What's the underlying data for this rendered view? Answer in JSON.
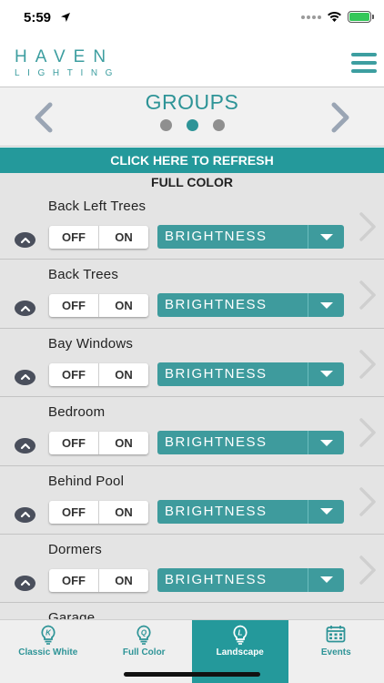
{
  "status_bar": {
    "time": "5:59"
  },
  "header": {
    "logo_main": "HAVEN",
    "logo_sub": "LIGHTING"
  },
  "groups_nav": {
    "title": "GROUPS",
    "pages": 3,
    "active_page": 2
  },
  "refresh": {
    "label": "CLICK HERE TO REFRESH"
  },
  "section": {
    "title": "FULL COLOR"
  },
  "controls": {
    "off_label": "OFF",
    "on_label": "ON",
    "brightness_label": "BRIGHTNESS"
  },
  "groups": [
    {
      "name": "Back Left Trees"
    },
    {
      "name": "Back Trees"
    },
    {
      "name": "Bay Windows"
    },
    {
      "name": "Bedroom"
    },
    {
      "name": "Behind Pool"
    },
    {
      "name": "Dormers"
    },
    {
      "name": "Garage"
    }
  ],
  "tabs": [
    {
      "label": "Classic White",
      "icon": "bulb-k-icon",
      "letter": "K",
      "active": false
    },
    {
      "label": "Full Color",
      "icon": "bulb-q-icon",
      "letter": "Q",
      "active": false
    },
    {
      "label": "Landscape",
      "icon": "bulb-l-icon",
      "letter": "L",
      "active": true
    },
    {
      "label": "Events",
      "icon": "calendar-icon",
      "letter": "",
      "active": false
    }
  ],
  "colors": {
    "teal": "#24999b",
    "teal_title": "#2e9497",
    "list_bg": "#e4e4e4"
  }
}
